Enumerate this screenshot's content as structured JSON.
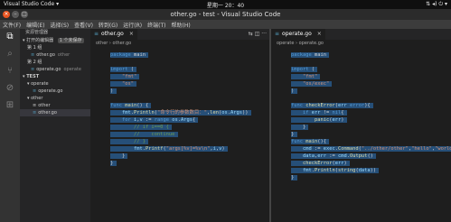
{
  "system": {
    "app_menu": "Visual Studio Code ▾",
    "clock": "星期一 20：40",
    "tray": "⇅ ◂) ⏻ ▾"
  },
  "window": {
    "title": "other.go - test - Visual Studio Code",
    "close": "×",
    "min": "–",
    "max": "□"
  },
  "menu": [
    "文件(F)",
    "编辑(E)",
    "选择(S)",
    "查看(V)",
    "转到(G)",
    "运行(R)",
    "终端(T)",
    "帮助(H)"
  ],
  "activity_icons": [
    "files-icon",
    "search-icon",
    "source-control-icon",
    "run-debug-icon",
    "extensions-icon"
  ],
  "sidebar": {
    "header": "资源管理器",
    "open_editors_label": "打开的编辑器",
    "open_editors_badge": "1 个未保存",
    "group1": "第 1 组",
    "group1_file": "other.go",
    "group1_dir": "other",
    "group2": "第 2 组",
    "group2_file": "operate.go",
    "group2_dir": "operate",
    "workspace": "TEST",
    "tree": [
      {
        "label": "operate",
        "kind": "folder",
        "depth": 1
      },
      {
        "label": "operate.go",
        "kind": "file",
        "depth": 2
      },
      {
        "label": "other",
        "kind": "folder",
        "depth": 1
      },
      {
        "label": "other",
        "kind": "file",
        "depth": 2
      },
      {
        "label": "other.go",
        "kind": "file",
        "depth": 2
      }
    ]
  },
  "left_editor": {
    "tab": "other.go",
    "crumb_folder": "other",
    "crumb_file": "other.go"
  },
  "right_editor": {
    "tab": "operate.go",
    "crumb_folder": "operate",
    "crumb_file": "operate.go"
  },
  "tab_actions": "⇆ ◫ ···"
}
